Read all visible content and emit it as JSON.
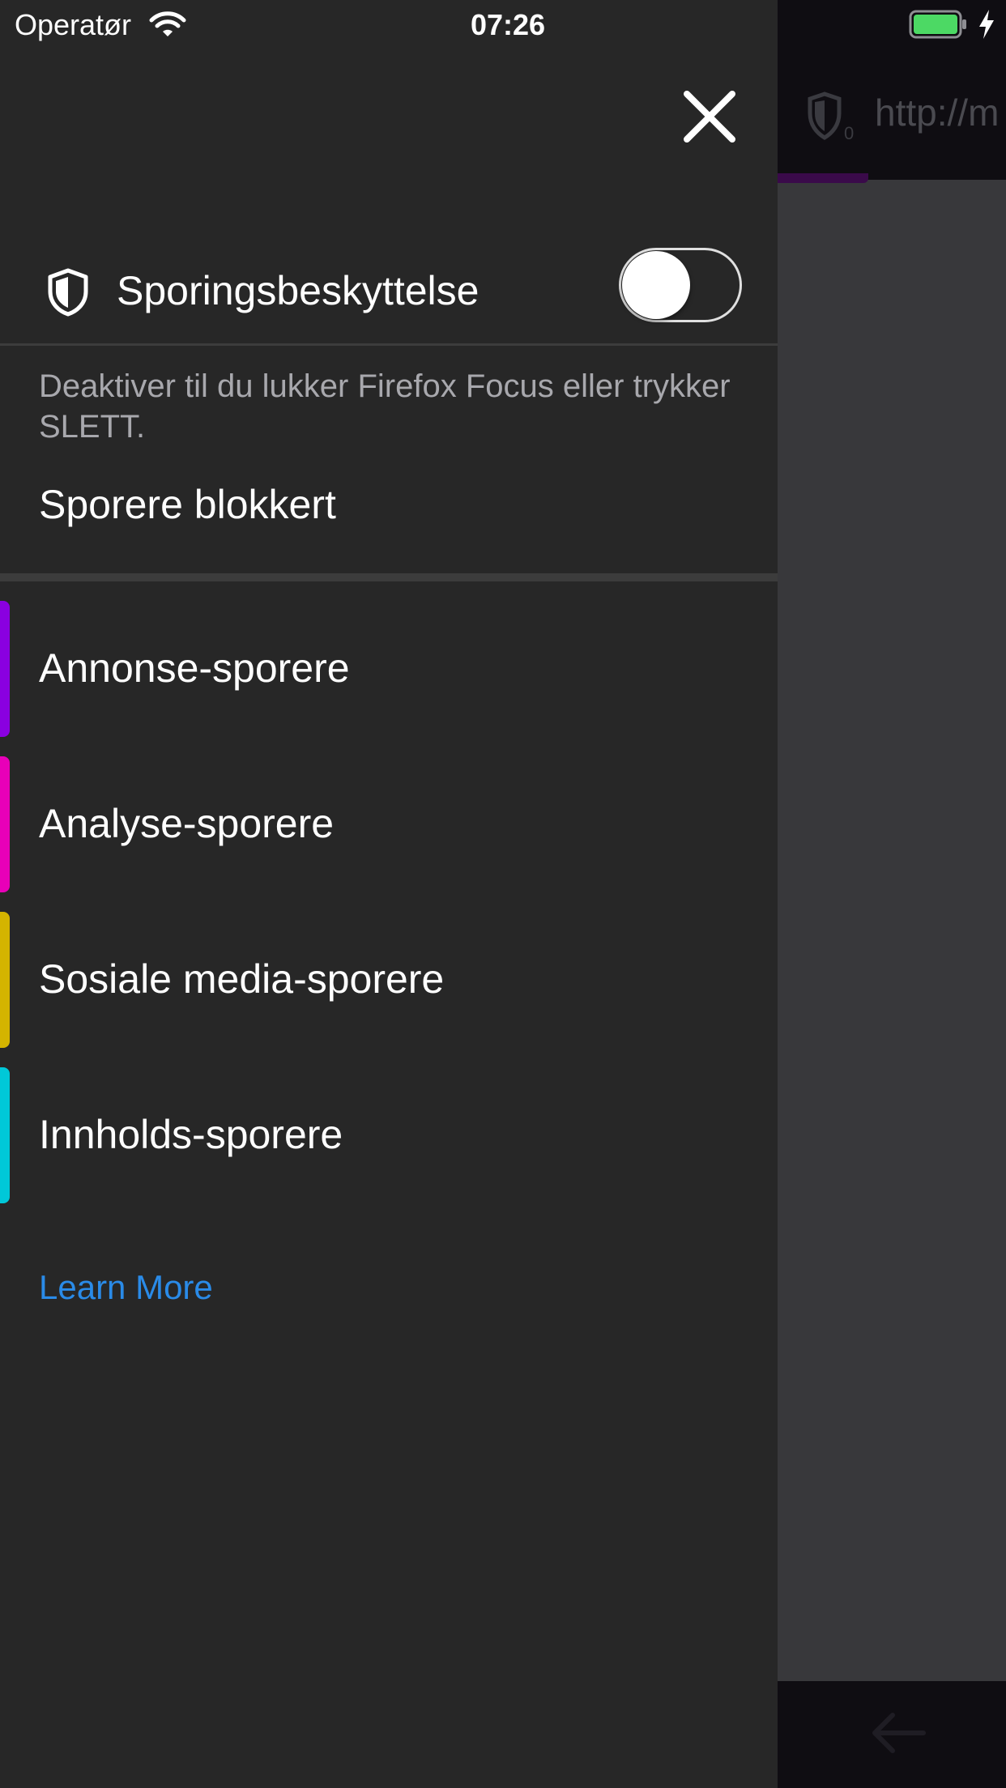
{
  "status_bar": {
    "carrier": "Operatør",
    "time": "07:26"
  },
  "background_browser": {
    "url_text": "http://m"
  },
  "tracking_protection": {
    "label": "Sporingsbeskyttelse",
    "enabled": false,
    "description": "Deaktiver til du lukker Firefox Focus eller trykker SLETT."
  },
  "trackers_blocked_title": "Sporere blokkert",
  "categories": [
    {
      "label": "Annonse-sporere",
      "color": "#8a00e0"
    },
    {
      "label": "Analyse-sporere",
      "color": "#e800b8"
    },
    {
      "label": "Sosiale media-sporere",
      "color": "#d4b400"
    },
    {
      "label": "Innholds-sporere",
      "color": "#00c8d8"
    }
  ],
  "learn_more": "Learn More",
  "colors": {
    "drawer_bg": "#272727",
    "link": "#2a8be8",
    "battery": "#4cd964"
  }
}
